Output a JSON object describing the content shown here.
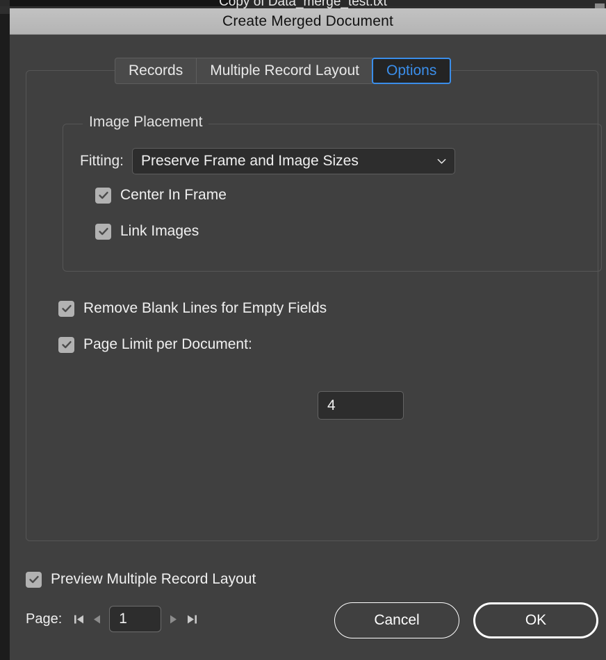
{
  "background_window": {
    "document_title": "Copy of Data_merge_test.txt"
  },
  "dialog": {
    "title": "Create Merged Document",
    "tabs": [
      {
        "label": "Records",
        "selected": false
      },
      {
        "label": "Multiple Record Layout",
        "selected": false
      },
      {
        "label": "Options",
        "selected": true
      }
    ],
    "accent_color": "#3b8eea",
    "background_color": "#404040",
    "titlebar_color": "#b8b8b8",
    "image_placement": {
      "legend": "Image Placement",
      "fitting_label": "Fitting:",
      "fitting_value": "Preserve Frame and Image Sizes",
      "fitting_icon": "chevron-down-icon",
      "center_in_frame": {
        "label": "Center In Frame",
        "checked": true
      },
      "link_images": {
        "label": "Link Images",
        "checked": true
      }
    },
    "remove_blank_lines": {
      "label": "Remove Blank Lines for Empty Fields",
      "checked": true
    },
    "page_limit": {
      "label": "Page Limit per Document:",
      "checked": true,
      "value": "4"
    },
    "preview_multiple_record_layout": {
      "label": "Preview Multiple Record Layout",
      "checked": true
    },
    "page_nav": {
      "label": "Page:",
      "value": "1",
      "first_icon": "first-page-icon",
      "prev_icon": "previous-page-icon",
      "next_icon": "next-page-icon",
      "last_icon": "last-page-icon"
    },
    "buttons": {
      "cancel": "Cancel",
      "ok": "OK"
    }
  }
}
